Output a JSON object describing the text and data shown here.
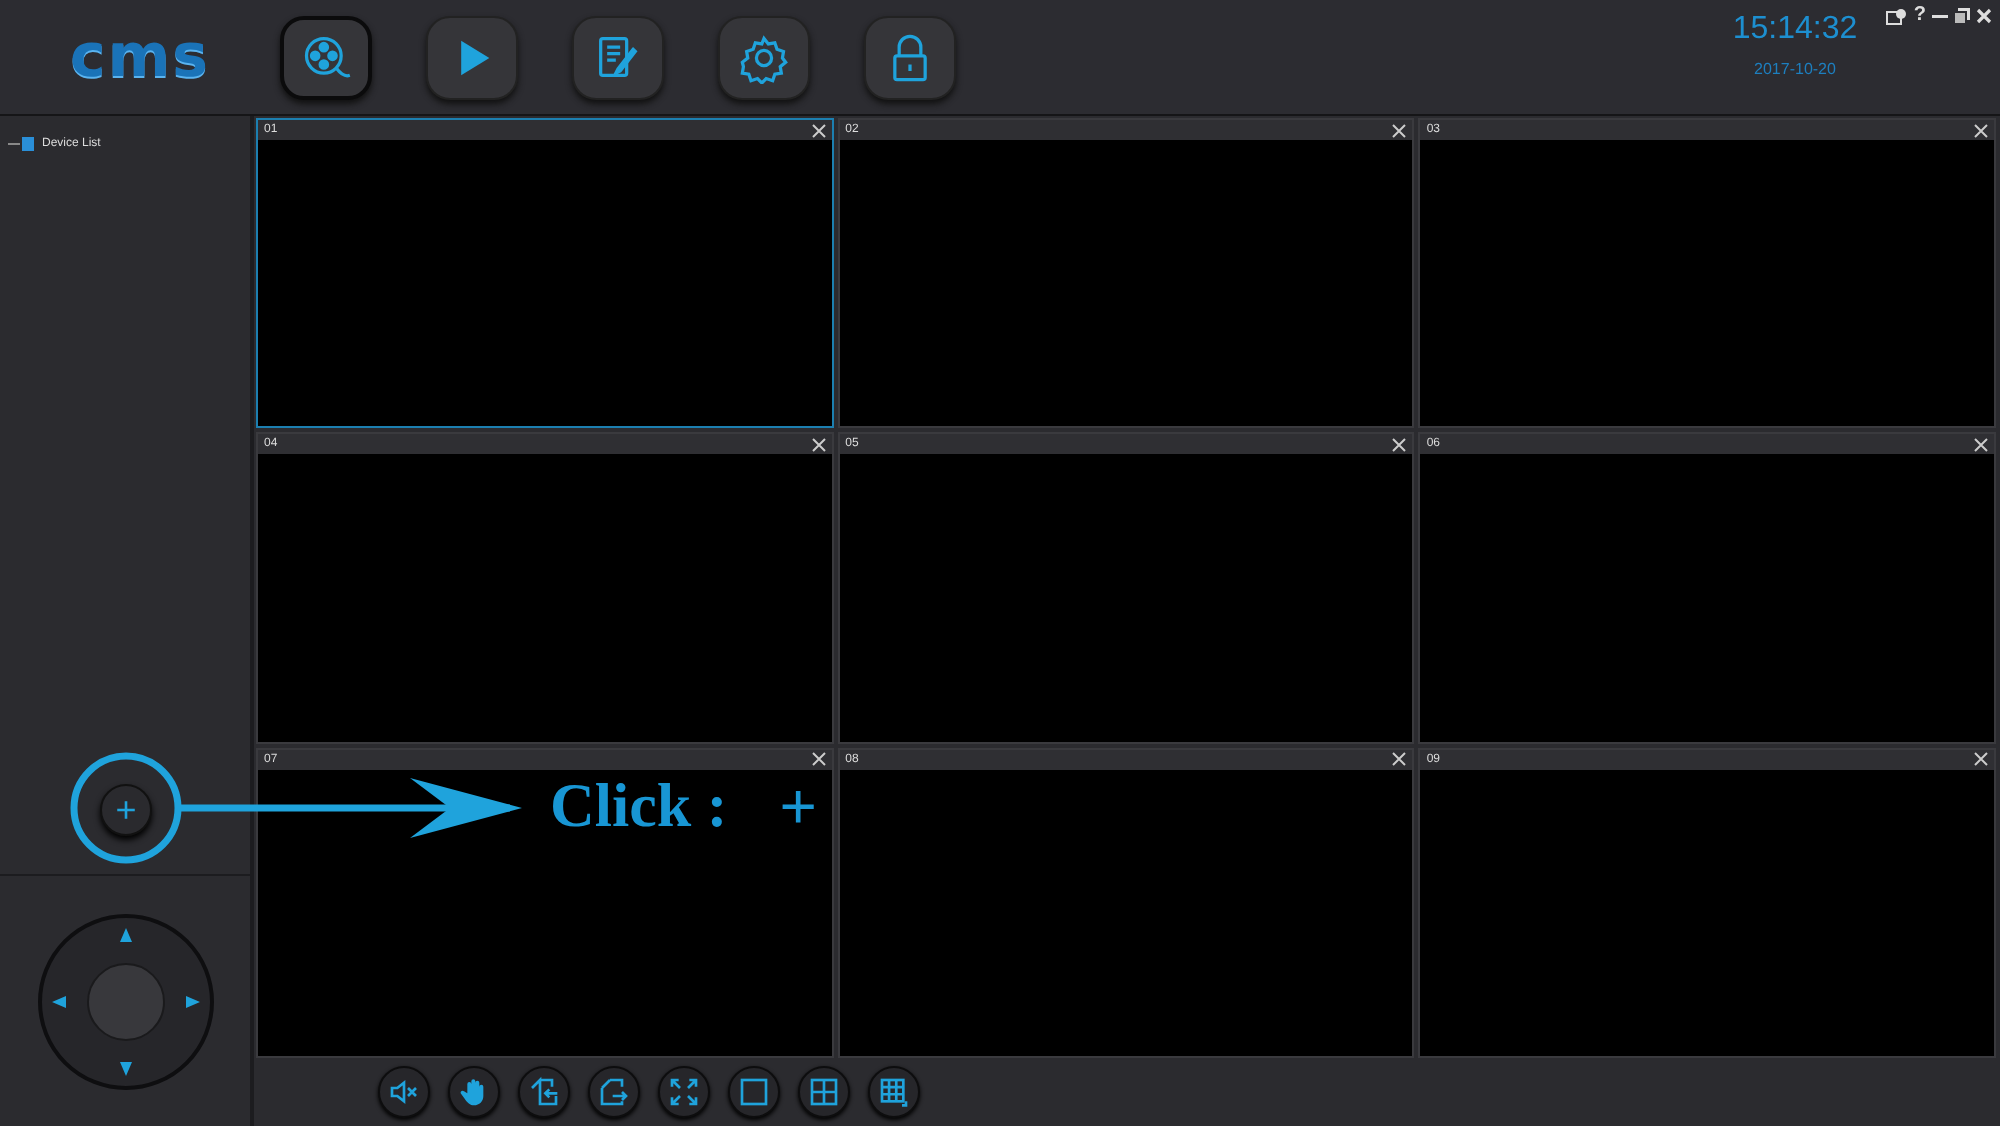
{
  "logo": "cms",
  "nav": [
    {
      "kind": "reel",
      "selected": true
    },
    {
      "kind": "play",
      "selected": false
    },
    {
      "kind": "edit",
      "selected": false
    },
    {
      "kind": "settings",
      "selected": false
    },
    {
      "kind": "lock",
      "selected": false
    }
  ],
  "clock": {
    "time": "15:14:32",
    "date": "2017-10-20"
  },
  "window_controls": {
    "help": "?"
  },
  "sidebar": {
    "items": [
      {
        "label": "Device List"
      }
    ]
  },
  "tiles": [
    {
      "label": "01",
      "selected": true
    },
    {
      "label": "02",
      "selected": false
    },
    {
      "label": "03",
      "selected": false
    },
    {
      "label": "04",
      "selected": false
    },
    {
      "label": "05",
      "selected": false
    },
    {
      "label": "06",
      "selected": false
    },
    {
      "label": "07",
      "selected": false
    },
    {
      "label": "08",
      "selected": false
    },
    {
      "label": "09",
      "selected": false
    }
  ],
  "annotation": {
    "text": "Click :",
    "symbol": "+"
  },
  "toolbar": [
    {
      "kind": "mute"
    },
    {
      "kind": "hand"
    },
    {
      "kind": "import"
    },
    {
      "kind": "export"
    },
    {
      "kind": "fullscreen"
    },
    {
      "kind": "single"
    },
    {
      "kind": "quad"
    },
    {
      "kind": "nine"
    }
  ]
}
